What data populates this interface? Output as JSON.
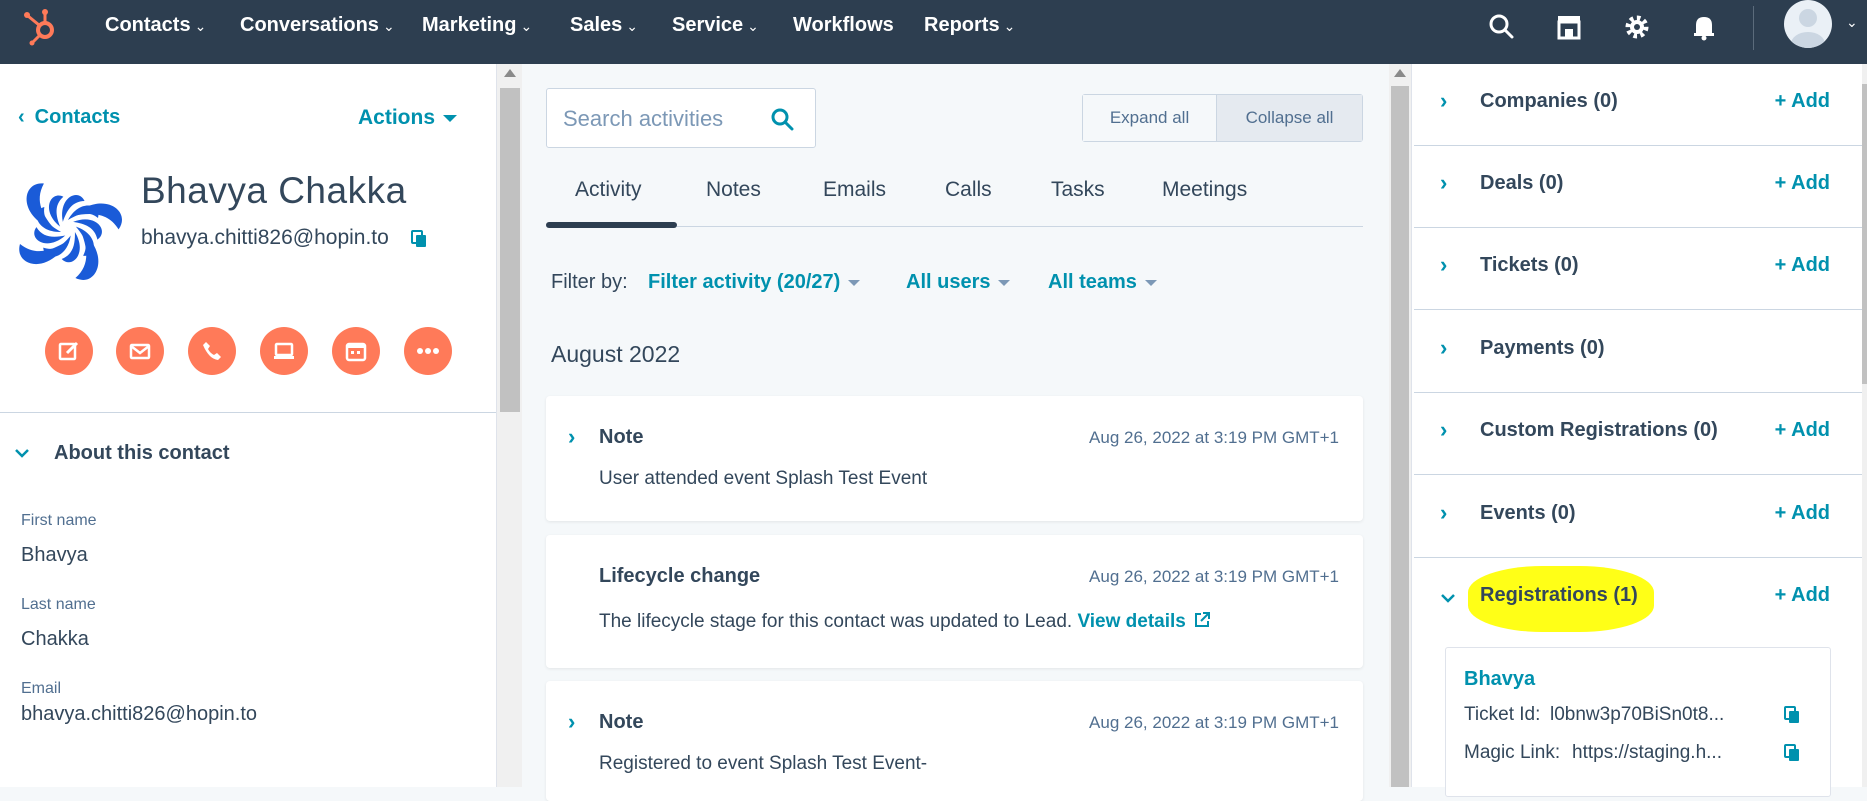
{
  "nav": {
    "items": [
      "Contacts",
      "Conversations",
      "Marketing",
      "Sales",
      "Service",
      "Workflows",
      "Reports"
    ],
    "caret": "⌄"
  },
  "left": {
    "back_label": "Contacts",
    "back_chevron": "‹",
    "actions_label": "Actions",
    "contact_name": "Bhavya Chakka",
    "contact_email": "bhavya.chitti826@hopin.to",
    "about_label": "About this contact",
    "props": [
      {
        "label": "First name",
        "value": "Bhavya"
      },
      {
        "label": "Last name",
        "value": "Chakka"
      },
      {
        "label": "Email",
        "value": "bhavya.chitti826@hopin.to"
      }
    ]
  },
  "middle": {
    "search_placeholder": "Search activities",
    "expand_all": "Expand all",
    "collapse_all": "Collapse all",
    "tabs": [
      "Activity",
      "Notes",
      "Emails",
      "Calls",
      "Tasks",
      "Meetings"
    ],
    "filter_by": "Filter by:",
    "filter_activity": "Filter activity (20/27)",
    "all_users": "All users",
    "all_teams": "All teams",
    "month": "August 2022",
    "cards": [
      {
        "title": "Note",
        "date": "Aug 26, 2022 at 3:19 PM GMT+1",
        "body": "User attended event Splash Test Event"
      },
      {
        "title": "Lifecycle change",
        "date": "Aug 26, 2022 at 3:19 PM GMT+1",
        "body": "The lifecycle stage for this contact was updated to Lead.",
        "link": "View details"
      },
      {
        "title": "Note",
        "date": "Aug 26, 2022 at 3:19 PM GMT+1",
        "body": "Registered to event Splash Test Event-"
      }
    ]
  },
  "right": {
    "add_label": "+ Add",
    "sections": [
      {
        "title": "Companies (0)"
      },
      {
        "title": "Deals (0)"
      },
      {
        "title": "Tickets (0)"
      },
      {
        "title": "Payments (0)"
      },
      {
        "title": "Custom Registrations (0)"
      },
      {
        "title": "Events (0)"
      },
      {
        "title": "Registrations (1)"
      }
    ],
    "registration": {
      "name": "Bhavya",
      "ticket_label": "Ticket Id:",
      "ticket_value": "l0bnw3p70BiSn0t8...",
      "magic_label": "Magic Link:",
      "magic_value": "https://staging.h..."
    }
  },
  "colors": {
    "nav_bg": "#2d3e50",
    "accent": "#0091ae",
    "orange": "#ff7a59",
    "highlight": "#ffff17"
  }
}
